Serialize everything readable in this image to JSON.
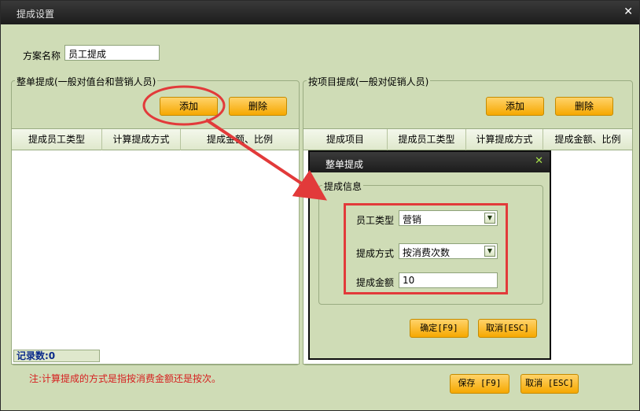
{
  "window": {
    "title": "提成设置"
  },
  "scheme": {
    "label": "方案名称",
    "value": "员工提成"
  },
  "left_panel": {
    "title": "整单提成(一般对值台和营销人员)",
    "add_label": "添加",
    "delete_label": "删除",
    "columns": [
      "提成员工类型",
      "计算提成方式",
      "提成金额、比例"
    ],
    "records_label": "记录数:0"
  },
  "right_panel": {
    "title": "按项目提成(一般对促销人员)",
    "add_label": "添加",
    "delete_label": "删除",
    "columns": [
      "提成项目",
      "提成员工类型",
      "计算提成方式",
      "提成金额、比例"
    ]
  },
  "note": "注:计算提成的方式是指按消费金额还是按次。",
  "footer": {
    "save_label": "保存 [F9]",
    "cancel_label": "取消 [ESC]"
  },
  "dialog": {
    "title": "整单提成",
    "group_title": "提成信息",
    "employee_type_label": "员工类型",
    "employee_type_value": "营销",
    "method_label": "提成方式",
    "method_value": "按消费次数",
    "amount_label": "提成金额",
    "amount_value": "10",
    "ok_label": "确定[F9]",
    "cancel_label": "取消[ESC]"
  },
  "colors": {
    "panel_bg": "#cfdcb6",
    "button": "#f6a800",
    "annotation": "#e23a3a"
  },
  "icons": {
    "close": "close-icon",
    "dropdown": "chevron-down-icon"
  }
}
